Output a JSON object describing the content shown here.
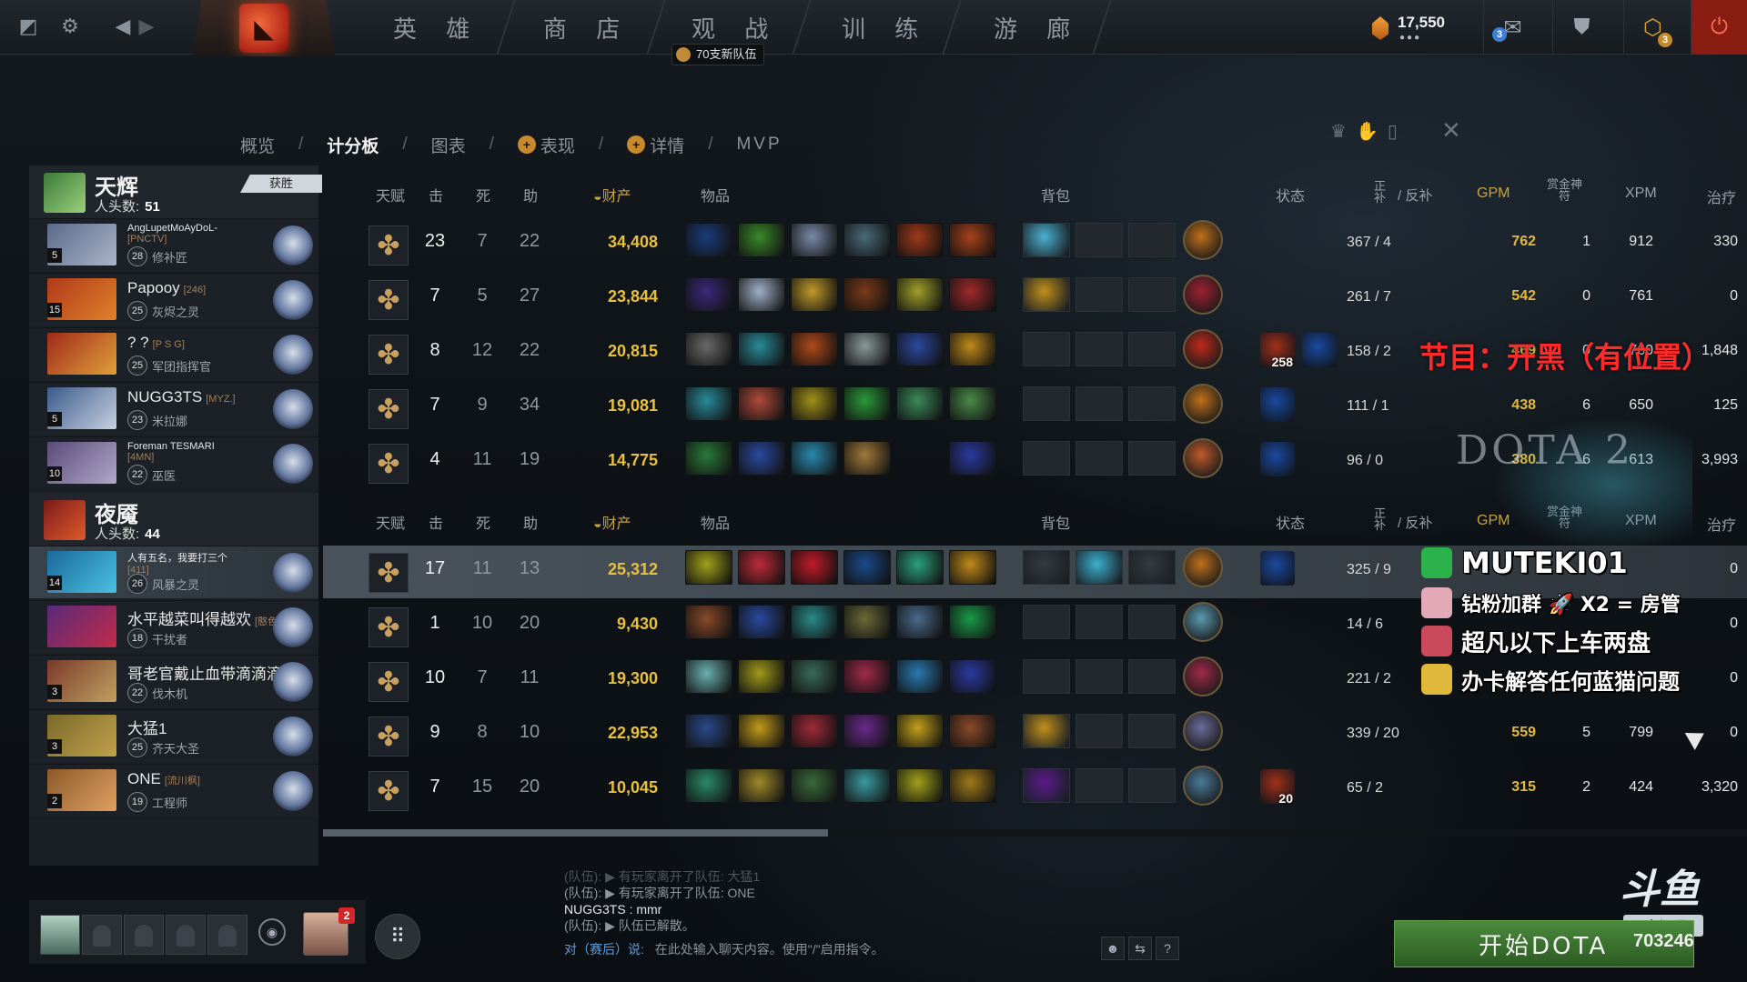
{
  "topbar": {
    "nav": [
      "英 雄",
      "商 店",
      "观 战",
      "训 练",
      "游 廊"
    ],
    "watch_badge": "70支新队伍",
    "shards": "17,550",
    "shards_dots": "●●●",
    "mail_count": "3",
    "cosmetic_count": "3"
  },
  "subtabs": {
    "overview": "概览",
    "scoreboard": "计分板",
    "graphs": "图表",
    "performance": "表现",
    "details": "详情",
    "mvp": "MVP",
    "sep": "/"
  },
  "headers": {
    "talent": "天赋",
    "kills": "击",
    "deaths": "死",
    "assists": "助",
    "networth": "财产",
    "items": "物品",
    "backpack": "背包",
    "status": "状态",
    "lasthit_top": "正",
    "lasthit_bottom": "补",
    "denies": "/ 反补",
    "gpm": "GPM",
    "bounty_top": "赏金神",
    "bounty_bottom": "符",
    "xpm": "XPM",
    "heal": "治疗"
  },
  "radiant": {
    "name": "天辉",
    "kills_label": "人头数:",
    "kills": "51",
    "result": "获胜",
    "players": [
      {
        "name": "AngLupetMoAyDoL-",
        "name2": "[PNCTV]",
        "small": true,
        "hero": "修补匠",
        "level": "28",
        "slot": "5",
        "colors": [
          "#5a6a8a",
          "#a8b4c8"
        ],
        "kills": "23",
        "deaths": "7",
        "assists": "22",
        "networth": "34,408",
        "items": [
          "#1a3c7a",
          "#3a8a2a",
          "#7a8aa8",
          "#4a6a7a",
          "#a03a1a",
          "#a8421a"
        ],
        "backpack": [
          "#4ab0d0",
          null,
          null
        ],
        "neutral": "#c0701a",
        "status": [],
        "lh": "367",
        "dn": "4",
        "gpm": "762",
        "bounty": "1",
        "xpm": "912",
        "heal": "330"
      },
      {
        "name": "Papooy",
        "tag": "[246]",
        "hero": "灰烬之灵",
        "level": "25",
        "slot": "15",
        "colors": [
          "#b03a1a",
          "#e0802a"
        ],
        "kills": "7",
        "deaths": "5",
        "assists": "27",
        "networth": "23,844",
        "items": [
          "#3a2a7a",
          "#a0b0c8",
          "#c09a2a",
          "#7a3a1a",
          "#a0a02a",
          "#a02a2a"
        ],
        "backpack": [
          "#c0901a",
          null,
          null
        ],
        "neutral": "#a02030",
        "status": [],
        "lh": "261",
        "dn": "7",
        "gpm": "542",
        "bounty": "0",
        "xpm": "761",
        "heal": "0"
      },
      {
        "name": "? ?",
        "tag": "[P S G]",
        "hero": "军团指挥官",
        "level": "25",
        "slot": "",
        "colors": [
          "#a02a1a",
          "#e0a03a"
        ],
        "kills": "8",
        "deaths": "12",
        "assists": "22",
        "networth": "20,815",
        "items": [
          "#6a6a6a",
          "#2a8a9a",
          "#b04a1a",
          "#8a9a9a",
          "#2a4aa0",
          "#c08a1a"
        ],
        "backpack": [
          null,
          null,
          null
        ],
        "neutral": "#c02a1a",
        "status": [
          {
            "color": "#a0301a",
            "num": "258"
          },
          {
            "color": "#1a4aa0",
            "num": ""
          }
        ],
        "lh": "158",
        "dn": "2",
        "gpm": "469",
        "bounty": "0",
        "xpm": "760",
        "heal": "1,848"
      },
      {
        "name": "NUGG3TS",
        "tag": "[MYZ.]",
        "hero": "米拉娜",
        "level": "23",
        "slot": "5",
        "colors": [
          "#3a5a8a",
          "#c8d0e0"
        ],
        "kills": "7",
        "deaths": "9",
        "assists": "34",
        "networth": "19,081",
        "items": [
          "#2a8a9a",
          "#b04a3a",
          "#a0901a",
          "#2a9a3a",
          "#3a8a5a",
          "#4a8a4a"
        ],
        "backpack": [
          null,
          null,
          null
        ],
        "neutral": "#c0701a",
        "status": [
          {
            "color": "#1a4aa0",
            "num": ""
          }
        ],
        "lh": "111",
        "dn": "1",
        "gpm": "438",
        "bounty": "6",
        "xpm": "650",
        "heal": "125"
      },
      {
        "name": "Foreman TESMARI",
        "name2": "[4MN]",
        "small": true,
        "hero": "巫医",
        "level": "22",
        "slot": "10",
        "colors": [
          "#5a4a7a",
          "#b0a8c8"
        ],
        "kills": "4",
        "deaths": "11",
        "assists": "19",
        "networth": "14,775",
        "items": [
          "#2a7a3a",
          "#2a4aa0",
          "#2a8ab0",
          "#a07a3a",
          null,
          "#2a3aa0"
        ],
        "backpack": [
          null,
          null,
          null
        ],
        "neutral": "#c05a2a",
        "status": [
          {
            "color": "#1a4aa0",
            "num": ""
          }
        ],
        "lh": "96",
        "dn": "0",
        "gpm": "380",
        "bounty": "6",
        "xpm": "613",
        "heal": "3,993"
      }
    ]
  },
  "dire": {
    "name": "夜魇",
    "kills_label": "人头数:",
    "kills": "44",
    "players": [
      {
        "name": "人有五名，我要打三个",
        "name2": "[411]",
        "small": true,
        "hero": "风暴之灵",
        "level": "26",
        "slot": "14",
        "colors": [
          "#1a6a9a",
          "#4ac0e0"
        ],
        "highlight": true,
        "kills": "17",
        "deaths": "11",
        "assists": "13",
        "networth": "25,312",
        "items": [
          "#a0a01a",
          "#c02a3a",
          "#c01a2a",
          "#1a4a8a",
          "#2aa07a",
          "#c08a1a"
        ],
        "backpack": [
          "#333a40",
          "#3ab0d0",
          "#333a40"
        ],
        "neutral": "#c0701a",
        "status": [
          {
            "color": "#1a4aa0",
            "num": ""
          }
        ],
        "lh": "325",
        "dn": "9",
        "gpm": "",
        "bounty": "",
        "xpm": "",
        "heal": "0"
      },
      {
        "name": "水平越菜叫得越欢",
        "tag": "[憨色]",
        "hero": "干扰者",
        "level": "18",
        "slot": "",
        "colors": [
          "#5a2a7a",
          "#c02a4a"
        ],
        "kills": "1",
        "deaths": "10",
        "assists": "20",
        "networth": "9,430",
        "items": [
          "#8a4a2a",
          "#2a4aa0",
          "#2a8a8a",
          "#6a6a3a",
          "#4a6a8a",
          "#1a9a4a"
        ],
        "backpack": [
          null,
          null,
          null
        ],
        "neutral": "#5a9ab0",
        "status": [],
        "lh": "14",
        "dn": "6",
        "gpm": "",
        "bounty": "",
        "xpm": "",
        "heal": "0"
      },
      {
        "name": "哥老官戴止血带滴滴滴",
        "tag": "[唐山人]",
        "hero": "伐木机",
        "level": "22",
        "slot": "3",
        "colors": [
          "#7a3a2a",
          "#c0a060"
        ],
        "kills": "10",
        "deaths": "7",
        "assists": "11",
        "networth": "19,300",
        "items": [
          "#6ab0b0",
          "#a09a1a",
          "#3a6a5a",
          "#a02a4a",
          "#2a7ab0",
          "#2a3aa0"
        ],
        "backpack": [
          null,
          null,
          null
        ],
        "neutral": "#a02a4a",
        "status": [],
        "lh": "221",
        "dn": "2",
        "gpm": "",
        "bounty": "",
        "xpm": "",
        "heal": "0"
      },
      {
        "name": "大猛1",
        "hero": "齐天大圣",
        "level": "25",
        "slot": "3",
        "colors": [
          "#7a6a2a",
          "#c0a04a"
        ],
        "kills": "9",
        "deaths": "8",
        "assists": "10",
        "networth": "22,953",
        "items": [
          "#2a4a8a",
          "#c09a1a",
          "#a02a3a",
          "#6a2a8a",
          "#c0a01a",
          "#8a4a2a"
        ],
        "backpack": [
          "#c0901a",
          null,
          null
        ],
        "neutral": "#6a6a9a",
        "status": [],
        "lh": "339",
        "dn": "20",
        "gpm": "559",
        "bounty": "5",
        "xpm": "799",
        "heal": "0"
      },
      {
        "name": "ONE",
        "tag": "[流川枫]",
        "hero": "工程师",
        "level": "19",
        "slot": "2",
        "colors": [
          "#8a5a2a",
          "#e0a060"
        ],
        "kills": "7",
        "deaths": "15",
        "assists": "20",
        "networth": "10,045",
        "items": [
          "#2a8a6a",
          "#a08a2a",
          "#3a6a3a",
          "#3a9aa0",
          "#a0a01a",
          "#a07a1a"
        ],
        "backpack": [
          "#5a1a8a",
          null,
          null
        ],
        "neutral": "#4a7a9a",
        "status": [
          {
            "color": "#a0301a",
            "num": "20"
          }
        ],
        "lh": "65",
        "dn": "2",
        "gpm": "315",
        "bounty": "2",
        "xpm": "424",
        "heal": "3,320"
      }
    ]
  },
  "overlay": {
    "red_text": "节目：开黑（有位置）",
    "dota2": "DOTA 2",
    "lines": [
      "MUTEKI01",
      "钻粉加群 🚀 X2 = 房管",
      "超凡以下上车两盘",
      "办卡解答任何蓝猫问题"
    ],
    "douyu_logo": "斗鱼",
    "douyu_room": "房间号",
    "room_number": "703246"
  },
  "chat": {
    "lines": [
      {
        "text": "(队伍): ▶ 有玩家离开了队伍: 大猛1",
        "cls": "faded"
      },
      {
        "text": "(队伍): ▶ 有玩家离开了队伍: ONE",
        "cls": ""
      },
      {
        "text": "NUGG3TS : mmr",
        "cls": "white"
      },
      {
        "text": "(队伍): ▶ 队伍已解散。",
        "cls": ""
      }
    ],
    "channel": "对（赛后）说:",
    "placeholder": "在此处输入聊天内容。使用\"/\"启用指令。"
  },
  "bottom": {
    "friend_count": "2",
    "play_label": "开始DOTA"
  }
}
